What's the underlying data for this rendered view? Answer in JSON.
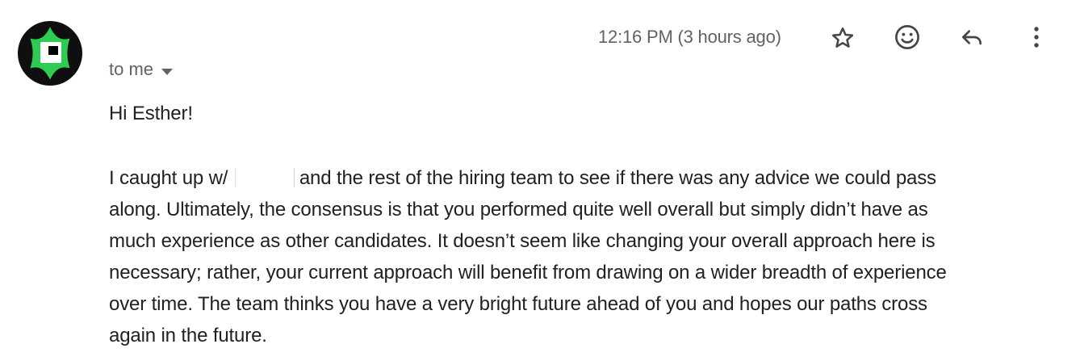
{
  "header": {
    "timestamp": "12:16 PM (3 hours ago)",
    "recipient_label": "to me",
    "actions": [
      {
        "icon": "star-icon"
      },
      {
        "icon": "emoji-icon"
      },
      {
        "icon": "reply-icon"
      },
      {
        "icon": "more-vert-icon"
      }
    ]
  },
  "sender": {
    "avatar_icon": "sender-logo-icon",
    "colors": {
      "ring": "#0f0f0f",
      "shape": "#2ecc52",
      "mark_white": "#ffffff",
      "mark_black": "#000000"
    }
  },
  "message": {
    "greeting": "Hi Esther!",
    "line1_before": "I caught up w/",
    "line1_after": "and the rest of the hiring team to see if there was any advice we could pass",
    "lines": [
      "along. Ultimately, the consensus is that you performed quite well overall but simply didn’t have as",
      "much experience as other candidates. It doesn’t seem like changing your overall approach here is",
      "necessary; rather, your current approach will benefit from drawing on a wider breadth of experience",
      "over time. The team thinks you have a very bright future ahead of you and hopes our paths cross",
      "again in the future."
    ]
  }
}
